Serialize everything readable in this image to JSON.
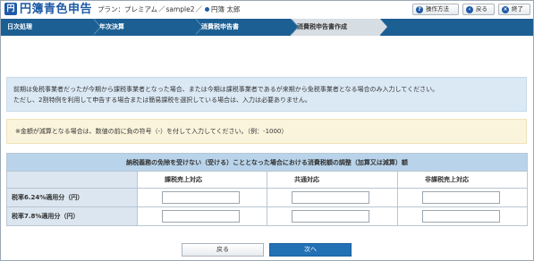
{
  "header": {
    "logo_icon": "円",
    "app_title": "円簿青色申告",
    "plan_label": "プラン：プレミアム",
    "plan_separator": "／",
    "company": "sample2",
    "plan_separator2": "／",
    "user_name": "円簿 太郎",
    "buttons": {
      "help": "操作方法",
      "back": "戻る",
      "close": "終了"
    }
  },
  "tabs": [
    {
      "label": "日次処理"
    },
    {
      "label": "年次決算"
    },
    {
      "label": "消費税申告書"
    },
    {
      "label": "消費税申告書作成"
    }
  ],
  "info": {
    "line1": "前期は免税事業者だったが今期から課税事業者となった場合、または今期は課税事業者であるが来期から免税事業者となる場合のみ入力してください。",
    "line2": "ただし、2割特例を利用して申告する場合または簡易課税を選択している場合は、入力は必要ありません。"
  },
  "warning": "※金額が減算となる場合は、数値の前に負の符号（-）を付して入力してください。（例：-1000）",
  "table": {
    "title": "納税義務の免除を受けない（受ける）こととなった場合における消費税額の調整（加算又は減算）額",
    "columns": [
      "課税売上対応",
      "共通対応",
      "非課税売上対応"
    ],
    "rows": [
      {
        "label": "税率6.24%適用分（円）",
        "values": [
          "",
          "",
          ""
        ]
      },
      {
        "label": "税率7.8%適用分（円）",
        "values": [
          "",
          "",
          ""
        ]
      }
    ]
  },
  "footer": {
    "back_label": "戻る",
    "next_label": "次へ"
  },
  "colors": {
    "brand": "#1f5aa6",
    "tabbar": "#1c5f93",
    "next_button": "#2370b5",
    "info_bg": "#dbe9f5",
    "warning_bg": "#fbf4dc",
    "table_title_bg": "#b9d4ea"
  }
}
